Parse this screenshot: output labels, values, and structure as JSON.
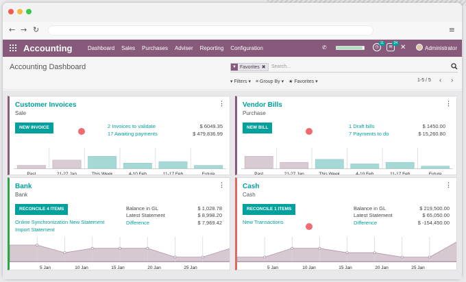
{
  "app": {
    "title": "Accounting",
    "menu": [
      "Dashboard",
      "Sales",
      "Purchases",
      "Adviser",
      "Reporting",
      "Configuration"
    ],
    "user": "Administrator",
    "badges": {
      "activities": "11",
      "messages": "24"
    },
    "progress_fraction": 0.95,
    "icons": {
      "apps": "grid-icon",
      "phone": "phone-icon",
      "activity": "clock-icon",
      "chat": "chat-icon",
      "close": "close-icon"
    }
  },
  "control": {
    "breadcrumb": "Accounting Dashboard",
    "facet_label": "Favorites",
    "search_placeholder": "Search...",
    "filters": "Filters",
    "group_by": "Group By",
    "favorites": "Favorites",
    "pager": "1-5 / 5"
  },
  "cards": {
    "customer_invoices": {
      "title": "Customer Invoices",
      "sub": "Sale",
      "button": "NEW INVOICE",
      "line1": "2 Invoices to validate",
      "amount1": "$ 6049.35",
      "line2": "17 Awaiting payments",
      "amount2": "$ 479,836.99"
    },
    "vendor_bills": {
      "title": "Vendor Bills",
      "sub": "Purchase",
      "button": "NEW BILL",
      "line1": "1 Draft bills",
      "amount1": "$ 1450.00",
      "line2": "7 Payments to do",
      "amount2": "$ 15,260.80"
    },
    "bank": {
      "title": "Bank",
      "sub": "Bank",
      "button": "RECONCILE 4 ITEMS",
      "link1": "Online Synchronization New Statement",
      "link2": "Import Statement",
      "label1": "Balance in GL",
      "amount1": "$ 1,028.78",
      "label2": "Latest Statement",
      "amount2": "$ 8,998.20",
      "label3": "Difference",
      "amount3": "$ 7,969.42"
    },
    "cash": {
      "title": "Cash",
      "sub": "Cash",
      "button": "RECONCILE 1 ITEMS",
      "link1": "New Transactions",
      "label1": "Balance in GL",
      "amount1": "$ 219,500.00",
      "label2": "Latest Statement",
      "amount2": "$ 65,050.00",
      "label3": "Difference",
      "amount3": "$ -154,450.00"
    }
  },
  "chart_data": [
    {
      "type": "bar",
      "categories": [
        "Past",
        "21-27 Jan",
        "This Week",
        "4-10 Feb",
        "11-17 Feb",
        "Future"
      ],
      "values": [
        0.2,
        0.55,
        0.8,
        0.35,
        0.45,
        0.2
      ],
      "highlight_index": 2
    },
    {
      "type": "bar",
      "categories": [
        "Past",
        "21-27 Jan",
        "This Week",
        "4-10 Feb",
        "11-17 Feb",
        "Future"
      ],
      "values": [
        0.8,
        0.4,
        0.6,
        0.3,
        0.4,
        0.15
      ],
      "highlight_index": 2
    },
    {
      "type": "area",
      "x": [
        "5 Jan",
        "10 Jan",
        "15 Jan",
        "20 Jan",
        "25 Jan"
      ],
      "values": [
        0.75,
        0.75,
        0.4,
        0.6,
        0.6,
        0.6,
        0.2,
        0.2,
        0.6
      ]
    },
    {
      "type": "area",
      "x": [
        "5 Jan",
        "10 Jan",
        "15 Jan",
        "20 Jan",
        "25 Jan"
      ],
      "values": [
        0.2,
        0.2,
        0.6,
        0.6,
        0.4,
        0.4,
        0.2,
        0.2,
        0.9
      ]
    }
  ]
}
